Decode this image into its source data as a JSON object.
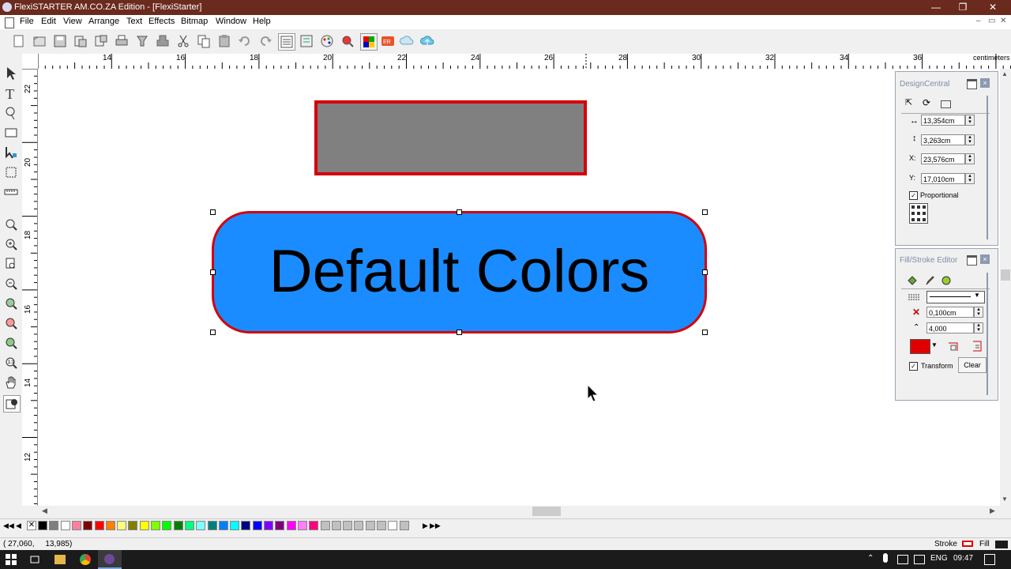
{
  "window": {
    "title": "FlexiSTARTER AM.CO.ZA Edition - [FlexiStarter]"
  },
  "menu": [
    "File",
    "Edit",
    "View",
    "Arrange",
    "Text",
    "Effects",
    "Bitmap",
    "Window",
    "Help"
  ],
  "ruler": {
    "unit": "centimeters",
    "h_ticks": [
      "14",
      "16",
      "18",
      "20",
      "22",
      "24",
      "26",
      "28",
      "30",
      "32",
      "34",
      "36"
    ],
    "v_ticks": [
      "22",
      "20",
      "18",
      "16",
      "14",
      "12"
    ]
  },
  "canvas_text": "Default Colors",
  "colors": {
    "title_bar": "#6b2a1e",
    "gray_rect_fill": "#808080",
    "stroke_red": "#d4000c",
    "blue_fill": "#1a8cff"
  },
  "design_central": {
    "title": "DesignCentral",
    "width": "13,354cm",
    "height": "3,263cm",
    "x_label": "X:",
    "x": "23,576cm",
    "y_label": "Y:",
    "y": "17,010cm",
    "proportional_label": "Proportional",
    "proportional_checked": true
  },
  "fill_stroke": {
    "title": "Fill/Stroke Editor",
    "width": "0,100cm",
    "miter": "4,000",
    "transform_label": "Transform",
    "transform_checked": true,
    "clear_label": "Clear",
    "stroke_color": "#e00000"
  },
  "status": {
    "coords": "( 27,060,     13,985)",
    "stroke_label": "Stroke",
    "fill_label": "Fill"
  },
  "taskbar": {
    "lang": "ENG",
    "time": "09:47"
  },
  "palette": [
    "#000000",
    "#7f7f7f",
    "#ffffff",
    "#ff7f9f",
    "#7f0000",
    "#ff0000",
    "#ff7f00",
    "#ffff7f",
    "#7f7f00",
    "#ffff00",
    "#7fff00",
    "#00ff00",
    "#007f00",
    "#00ff7f",
    "#7fffff",
    "#007f7f",
    "#007fff",
    "#00ffff",
    "#00007f",
    "#0000ff",
    "#7f00ff",
    "#7f007f",
    "#ff00ff",
    "#ff7fff",
    "#ff007f",
    "#c0c0c0",
    "#c0c0c0",
    "#c0c0c0",
    "#c0c0c0",
    "#c0c0c0",
    "#c0c0c0",
    "#ffffff",
    "#c0c0c0"
  ]
}
